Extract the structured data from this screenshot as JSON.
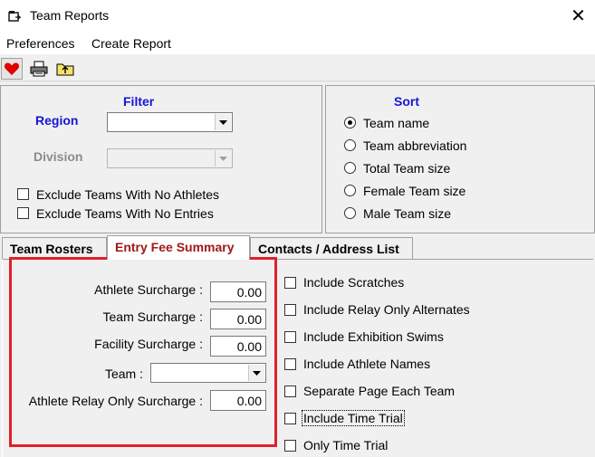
{
  "window": {
    "title": "Team Reports",
    "close": "✕"
  },
  "menu": {
    "items": [
      "Preferences",
      "Create Report"
    ]
  },
  "toolbar": {
    "icons": [
      "heart-icon",
      "printer-icon",
      "folder-up-icon"
    ]
  },
  "filter": {
    "title": "Filter",
    "region_label": "Region",
    "region_value": "",
    "division_label": "Division",
    "division_value": "",
    "exclude_no_athletes": "Exclude Teams With No Athletes",
    "exclude_no_entries": "Exclude Teams With No Entries"
  },
  "sort": {
    "title": "Sort",
    "options": [
      "Team name",
      "Team abbreviation",
      "Total Team size",
      "Female Team size",
      "Male Team size"
    ],
    "selected": "Team name"
  },
  "tabs": {
    "items": [
      "Team Rosters",
      "Entry Fee Summary",
      "Contacts / Address List"
    ],
    "active": "Entry Fee Summary"
  },
  "fees": {
    "athlete_label": "Athlete Surcharge :",
    "athlete_value": "0.00",
    "team_label": "Team Surcharge :",
    "team_value": "0.00",
    "facility_label": "Facility Surcharge :",
    "facility_value": "0.00",
    "team_select_label": "Team :",
    "team_select_value": "",
    "relay_label": "Athlete Relay Only Surcharge :",
    "relay_value": "0.00"
  },
  "options": {
    "items": [
      "Include Scratches",
      "Include Relay Only Alternates",
      "Include Exhibition Swims",
      "Include Athlete Names",
      "Separate Page Each Team",
      "Include Time Trial",
      "Only Time Trial"
    ]
  },
  "colors": {
    "highlight": "#e0202a",
    "label_blue": "#1515d6",
    "active_tab": "#a01818"
  }
}
